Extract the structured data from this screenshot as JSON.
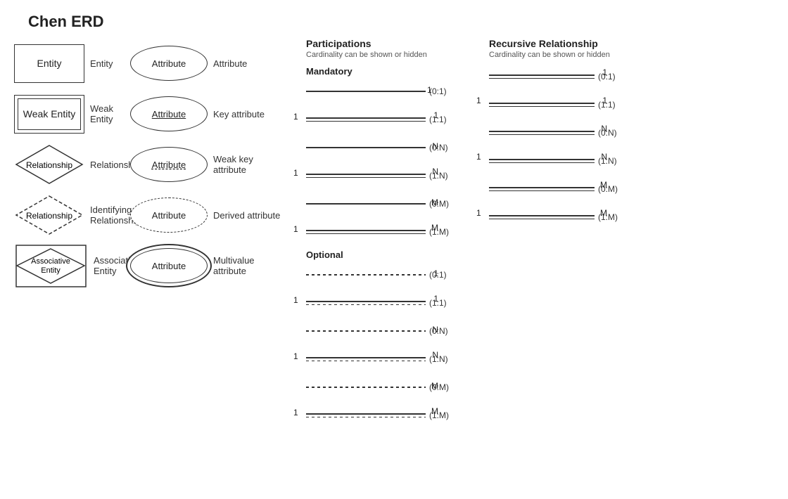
{
  "title": "Chen ERD",
  "shapes": {
    "items": [
      {
        "id": "entity",
        "label": "Entity",
        "description": "Entity"
      },
      {
        "id": "weak-entity",
        "label": "Weak Entity",
        "description": "Weak Entity"
      },
      {
        "id": "relationship",
        "label": "Relationship",
        "description": "Relationship"
      },
      {
        "id": "identifying-relationship",
        "label": "Relationship",
        "description": "Identifying Relationship"
      },
      {
        "id": "associative-entity",
        "label": "Associative Entity",
        "description": "Associative Entity"
      }
    ]
  },
  "attributes": {
    "items": [
      {
        "id": "attribute",
        "label": "Attribute",
        "description": "Attribute"
      },
      {
        "id": "key-attribute",
        "label": "Attribute",
        "description": "Key attribute"
      },
      {
        "id": "weak-key",
        "label": "Attribute",
        "description": "Weak key attribute"
      },
      {
        "id": "derived-attribute",
        "label": "Attribute",
        "description": "Derived attribute"
      },
      {
        "id": "multivalue-attribute",
        "label": "Attribute",
        "description": "Multivalue attribute"
      }
    ]
  },
  "participations": {
    "title": "Participations",
    "subtitle": "Cardinality can be shown or hidden",
    "mandatory_label": "Mandatory",
    "optional_label": "Optional",
    "mandatory": [
      {
        "left": "",
        "right": "1",
        "label": "(0:1)"
      },
      {
        "left": "1",
        "right": "1",
        "label": "(1:1)"
      },
      {
        "left": "",
        "right": "N",
        "label": "(0:N)"
      },
      {
        "left": "1",
        "right": "N",
        "label": "(1:N)"
      },
      {
        "left": "",
        "right": "M",
        "label": "(0:M)"
      },
      {
        "left": "1",
        "right": "M",
        "label": "(1:M)"
      }
    ],
    "optional": [
      {
        "left": "",
        "right": "1",
        "label": "(0:1)"
      },
      {
        "left": "1",
        "right": "1",
        "label": "(1:1)"
      },
      {
        "left": "",
        "right": "N",
        "label": "(0:N)"
      },
      {
        "left": "1",
        "right": "N",
        "label": "(1:N)"
      },
      {
        "left": "",
        "right": "M",
        "label": "(0:M)"
      },
      {
        "left": "1",
        "right": "M",
        "label": "(1:M)"
      }
    ]
  },
  "recursive": {
    "title": "Recursive Relationship",
    "subtitle": "Cardinality can be shown or hidden",
    "items": [
      {
        "left": "",
        "right": "1",
        "label": "(0:1)"
      },
      {
        "left": "1",
        "right": "1",
        "label": "(1:1)"
      },
      {
        "left": "",
        "right": "N",
        "label": "(0:N)"
      },
      {
        "left": "1",
        "right": "N",
        "label": "(1:N)"
      },
      {
        "left": "",
        "right": "M",
        "label": "(0:M)"
      },
      {
        "left": "1",
        "right": "M",
        "label": "(1:M)"
      }
    ]
  }
}
